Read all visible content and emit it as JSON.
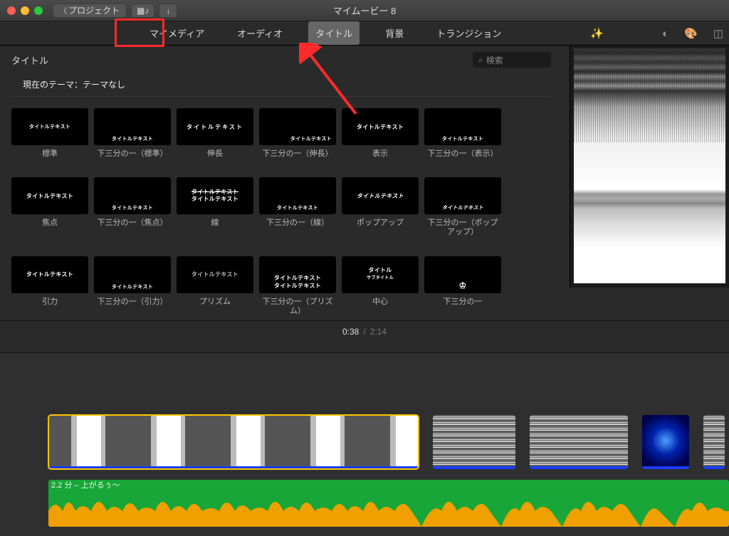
{
  "window": {
    "title": "マイムービー 8",
    "back_button": "プロジェクト"
  },
  "tabs": [
    {
      "label": "マイメディア"
    },
    {
      "label": "オーディオ"
    },
    {
      "label": "タイトル",
      "active": true
    },
    {
      "label": "背景"
    },
    {
      "label": "トランジション"
    }
  ],
  "section": {
    "title": "タイトル",
    "search_placeholder": "検索",
    "theme_line": "現在のテーマ：テーマなし"
  },
  "titles": [
    {
      "label": "標準"
    },
    {
      "label": "下三分の一（標準）"
    },
    {
      "label": "伸長"
    },
    {
      "label": "下三分の一（伸長）"
    },
    {
      "label": "表示"
    },
    {
      "label": "下三分の一（表示）"
    },
    {
      "label": "焦点"
    },
    {
      "label": "下三分の一（焦点）"
    },
    {
      "label": "線"
    },
    {
      "label": "下三分の一（線）"
    },
    {
      "label": "ポップアップ"
    },
    {
      "label": "下三分の一（ポップアップ）"
    },
    {
      "label": "引力"
    },
    {
      "label": "下三分の一（引力）"
    },
    {
      "label": "プリズム"
    },
    {
      "label": "下三分の一（プリズム）"
    },
    {
      "label": "中心"
    },
    {
      "label": "下三分の一"
    }
  ],
  "playback": {
    "current": "0:38",
    "duration": "2:14"
  },
  "audio": {
    "clip_label": "2.2 分 – 上がるぅ～"
  },
  "thumb_text": {
    "title_text": "タイトルテキスト",
    "title": "タイトル",
    "title_line1": "タイトルテキスト",
    "title_line2": "タイトルテキスト",
    "title_sub": "サブタイトル",
    "sample": "タイトルテキスト"
  }
}
